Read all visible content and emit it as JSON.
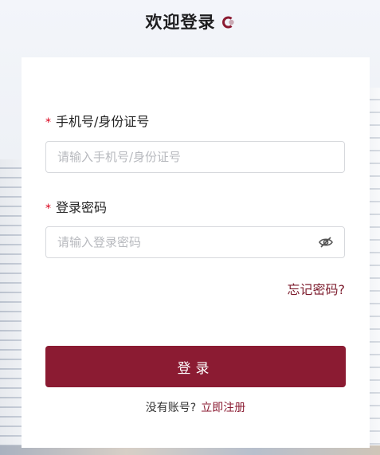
{
  "header": {
    "title": "欢迎登录"
  },
  "form": {
    "phone_label": "手机号/身份证号",
    "phone_placeholder": "请输入手机号/身份证号",
    "password_label": "登录密码",
    "password_placeholder": "请输入登录密码",
    "required_mark": "*",
    "forgot_link": "忘记密码?",
    "login_button": "登录",
    "no_account_text": "没有账号?",
    "register_link": "立即注册"
  },
  "icons": {
    "logo": "logo-icon",
    "password_visibility": "eye-off-icon"
  },
  "colors": {
    "brand": "#8b1b32",
    "required": "#d9001b"
  }
}
